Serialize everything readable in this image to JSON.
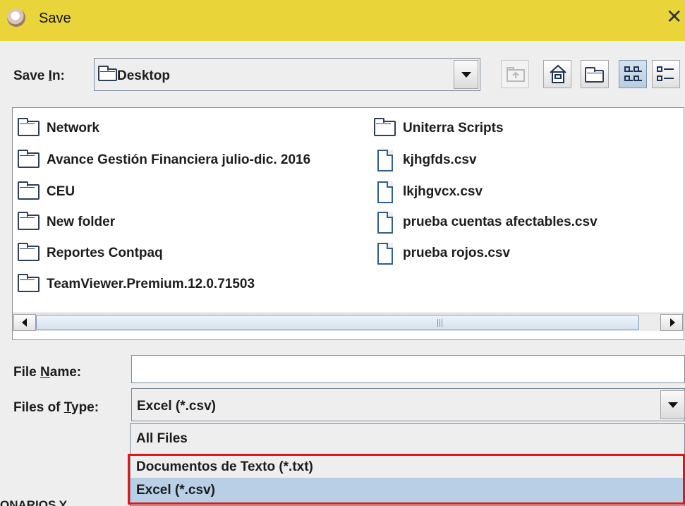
{
  "window": {
    "title": "Save",
    "close_symbol": "✕"
  },
  "save_in": {
    "label_pre": "Save ",
    "label_key": "I",
    "label_post": "n:",
    "value": "Desktop"
  },
  "toolbar": {
    "up": "up-one-level-icon",
    "home": "home-icon",
    "new_folder": "new-folder-icon",
    "list": "list-view-icon",
    "details": "details-view-icon"
  },
  "files": {
    "col1": [
      {
        "name": "Network",
        "kind": "folder"
      },
      {
        "name": "Avance Gestión Financiera julio-dic. 2016",
        "kind": "folder"
      },
      {
        "name": "CEU",
        "kind": "folder"
      },
      {
        "name": "New folder",
        "kind": "folder"
      },
      {
        "name": "Reportes Contpaq",
        "kind": "folder"
      },
      {
        "name": "TeamViewer.Premium.12.0.71503",
        "kind": "folder"
      }
    ],
    "col2": [
      {
        "name": "Uniterra Scripts",
        "kind": "folder"
      },
      {
        "name": "kjhgfds.csv",
        "kind": "file"
      },
      {
        "name": "lkjhgvcx.csv",
        "kind": "file"
      },
      {
        "name": "prueba cuentas afectables.csv",
        "kind": "file"
      },
      {
        "name": "prueba rojos.csv",
        "kind": "file"
      }
    ]
  },
  "file_name": {
    "label_pre": "File ",
    "label_key": "N",
    "label_post": "ame:",
    "value": ""
  },
  "file_type": {
    "label_pre": "Files of ",
    "label_key": "T",
    "label_post": "ype:",
    "value": "Excel (*.csv)",
    "options": [
      "All Files",
      "Documentos de Texto (*.txt)",
      "Excel (*.csv)"
    ],
    "selected_index": 2
  },
  "background_text": "ONARIOS Y",
  "colors": {
    "title_bar": "#e9d53a",
    "selection": "#b8cfe5",
    "highlight_box": "#e01717"
  }
}
